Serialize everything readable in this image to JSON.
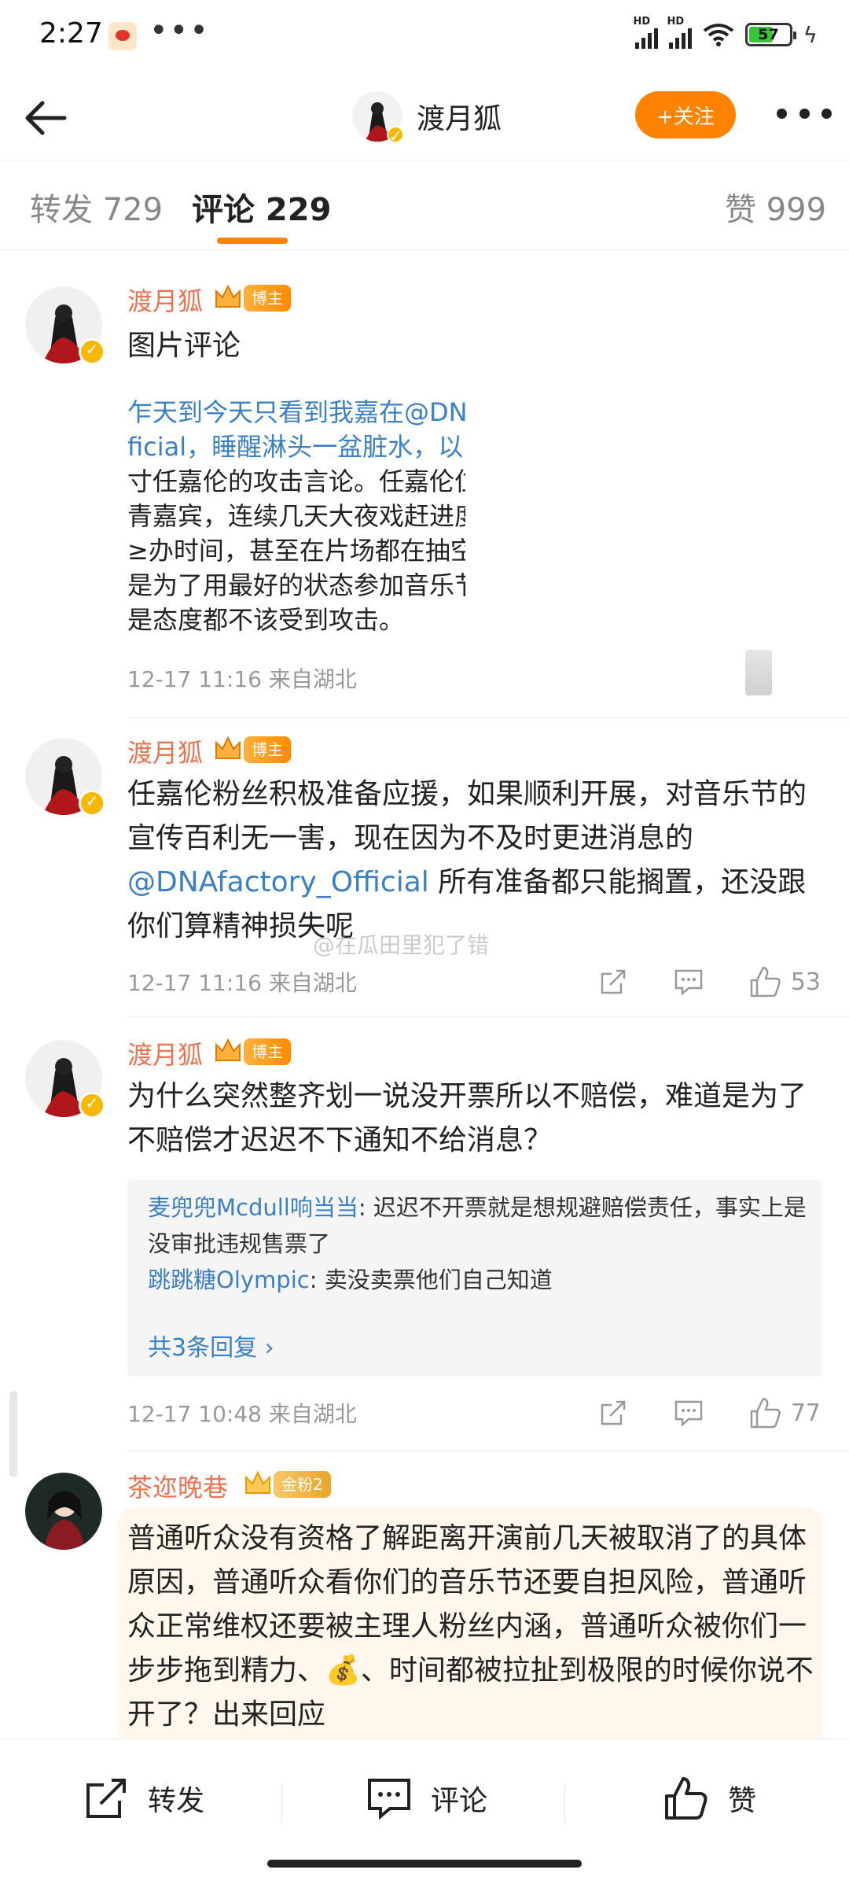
{
  "status_bar": {
    "time": "2:27",
    "dots": "•••",
    "battery": "57",
    "hd": "HD"
  },
  "nav": {
    "title": "渡月狐",
    "follow_label": "+关注"
  },
  "tabs": [
    {
      "label": "转发 729"
    },
    {
      "label": "评论 229"
    },
    {
      "label": "赞 999"
    }
  ],
  "comments": [
    {
      "name": "渡月狐",
      "tag": "博主",
      "crown_level": "6",
      "text": "图片评论",
      "image_lines": [
        "乍天到今天只看到我嘉在@DN",
        "ficial，睡醒淋头一盆脏水，以",
        "寸任嘉伦的攻击言论。任嘉伦位",
        "青嘉宾，连续几天大夜戏赶进度",
        "≥办时间，甚至在片场都在抽空",
        "是为了用最好的状态参加音乐节",
        "是态度都不该受到攻击。"
      ],
      "meta": "12-17 11:16  来自湖北"
    },
    {
      "name": "渡月狐",
      "tag": "博主",
      "crown_level": "6",
      "text_before": "任嘉伦粉丝积极准备应援，如果顺利开展，对音乐节的宣传百利无一害，现在因为不及时更进消息的",
      "mention": "@DNAfactory_Official",
      "text_after": " 所有准备都只能搁置，还没跟你们算精神损失呢",
      "meta": "12-17 11:16  来自湖北",
      "likes": "53"
    },
    {
      "name": "渡月狐",
      "tag": "博主",
      "crown_level": "6",
      "text": "为什么突然整齐划一说没开票所以不赔偿，难道是为了不赔偿才迟迟不下通知不给消息？",
      "replies": [
        {
          "name": "麦兜兜Mcdull响当当",
          "text": ": 迟迟不开票就是想规避赔偿责任，事实上是没审批违规售票了"
        },
        {
          "name": "跳跳糖Olympic",
          "text": ": 卖没卖票他们自己知道"
        }
      ],
      "reply_more": "共3条回复 ›",
      "meta": "12-17 10:48  来自湖北",
      "likes": "77"
    },
    {
      "name": "茶迩晚巷",
      "tag": "金粉2",
      "text_before": "普通听众没有资格了解距离开演前几天被取消了的具体原因，普通听众看你们的音乐节还要自担风险，普通听众正常维权还要被主理人粉丝内涵，普通听众被你们一步步拖到精力、",
      "emoji": "💰",
      "text_after": "、时间都被拉扯到极限的时候你说不开了？出来回应"
    }
  ],
  "watermark": "@在瓜田里犯了错",
  "toolbar": {
    "repost": "转发",
    "comment": "评论",
    "like": "赞"
  },
  "colors": {
    "accent": "#ff8200",
    "name": "#eb7350",
    "link": "#3b7fc4"
  }
}
